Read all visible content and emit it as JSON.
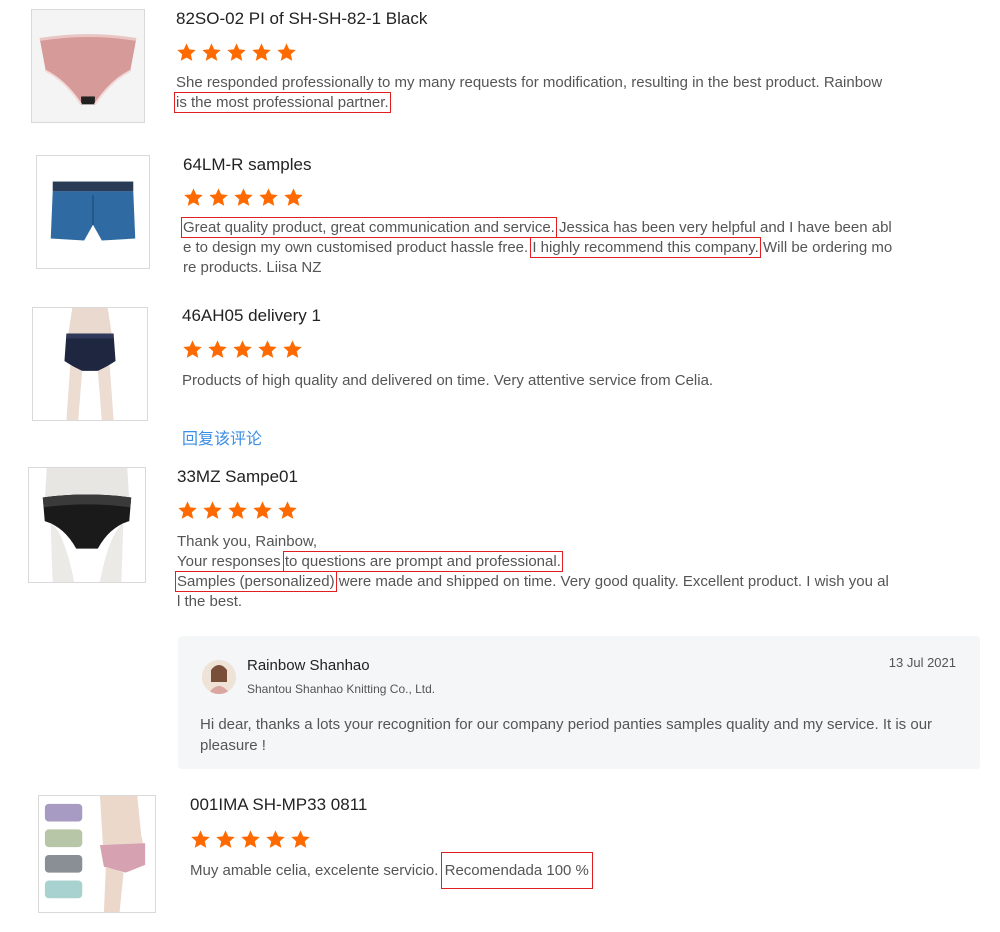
{
  "colors": {
    "star": "#ff6a00",
    "highlight_border": "#e02020",
    "link": "#3a8ee6",
    "reply_bg": "#f5f6f7"
  },
  "reviews": [
    {
      "title": "82SO-02 PI of SH-SH-82-1 Black",
      "rating": 5,
      "thumbnail_icon": "pink-brief-icon",
      "lines": [
        "She responded professionally to my many requests for modification, resulting in the best product. Rainbow",
        "is the most professional partner."
      ]
    },
    {
      "title": "64LM-R samples",
      "rating": 5,
      "thumbnail_icon": "blue-boxer-icon",
      "lines": [
        [
          "Great quality product, great communication and service.",
          " Jessica has been very helpful and I have been abl"
        ],
        [
          "e to design my own customised product hassle free. ",
          "I highly recommend this company.",
          " Will be ordering mo"
        ],
        "re products. Liisa NZ"
      ]
    },
    {
      "title": "46AH05 delivery 1",
      "rating": 5,
      "thumbnail_icon": "navy-brief-model-icon",
      "lines": [
        "Products of high quality and delivered on time. Very attentive service from Celia."
      ],
      "reply_link": "回复该评论"
    },
    {
      "title": "33MZ Sampe01",
      "rating": 5,
      "thumbnail_icon": "black-lace-brief-icon",
      "lines": [
        "Thank you, Rainbow,",
        [
          "Your responses ",
          "to questions are prompt and professional.",
          ""
        ],
        [
          "Samples (personalized)",
          " were made and shipped on time. Very good quality. Excellent product. I wish you al"
        ],
        "l the best."
      ],
      "seller_reply": {
        "name": "Rainbow Shanhao",
        "company": "Shantou Shanhao Knitting Co., Ltd.",
        "date": "13 Jul 2021",
        "text": "Hi dear, thanks a lots your  recognition for our company period panties samples quality and my service. It is our pleasure !"
      }
    },
    {
      "title": "001IMA SH-MP33 0811",
      "rating": 5,
      "thumbnail_icon": "maternity-brief-set-icon",
      "lines": [
        [
          "Muy amable celia, excelente servicio. ",
          "Recomendada 100 %"
        ]
      ]
    }
  ]
}
